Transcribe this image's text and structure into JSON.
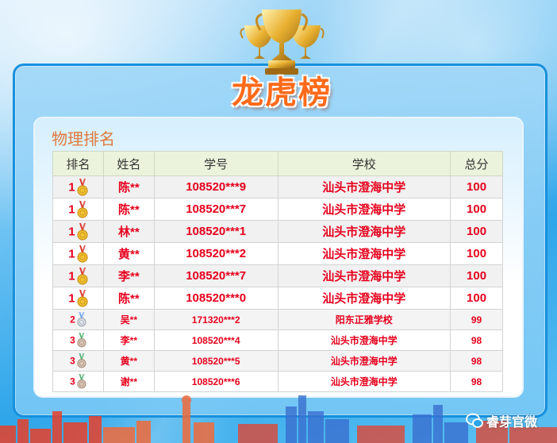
{
  "banner": {
    "title": "龙虎榜"
  },
  "panel": {
    "title": "物理排名"
  },
  "table": {
    "headers": [
      "排名",
      "姓名",
      "学号",
      "学校",
      "总分"
    ],
    "rows": [
      {
        "rank": "1",
        "medal": "gold",
        "name": "陈**",
        "id": "108520***9",
        "school": "汕头市澄海中学",
        "score": "100"
      },
      {
        "rank": "1",
        "medal": "gold",
        "name": "陈**",
        "id": "108520***7",
        "school": "汕头市澄海中学",
        "score": "100"
      },
      {
        "rank": "1",
        "medal": "gold",
        "name": "林**",
        "id": "108520***1",
        "school": "汕头市澄海中学",
        "score": "100"
      },
      {
        "rank": "1",
        "medal": "gold",
        "name": "黄**",
        "id": "108520***2",
        "school": "汕头市澄海中学",
        "score": "100"
      },
      {
        "rank": "1",
        "medal": "gold",
        "name": "李**",
        "id": "108520***7",
        "school": "汕头市澄海中学",
        "score": "100"
      },
      {
        "rank": "1",
        "medal": "gold",
        "name": "陈**",
        "id": "108520***0",
        "school": "汕头市澄海中学",
        "score": "100"
      },
      {
        "rank": "2",
        "medal": "silver",
        "name": "吴**",
        "id": "171320***2",
        "school": "阳东正雅学校",
        "score": "99"
      },
      {
        "rank": "3",
        "medal": "bronze",
        "name": "李**",
        "id": "108520***4",
        "school": "汕头市澄海中学",
        "score": "98"
      },
      {
        "rank": "3",
        "medal": "bronze",
        "name": "黄**",
        "id": "108520***5",
        "school": "汕头市澄海中学",
        "score": "98"
      },
      {
        "rank": "3",
        "medal": "bronze",
        "name": "谢**",
        "id": "108520***6",
        "school": "汕头市澄海中学",
        "score": "98"
      }
    ]
  },
  "watermark": {
    "text": "睿芽官微"
  },
  "colors": {
    "accent": "#e6001c",
    "title": "#ff6a1a",
    "frame": "#1790dd"
  }
}
